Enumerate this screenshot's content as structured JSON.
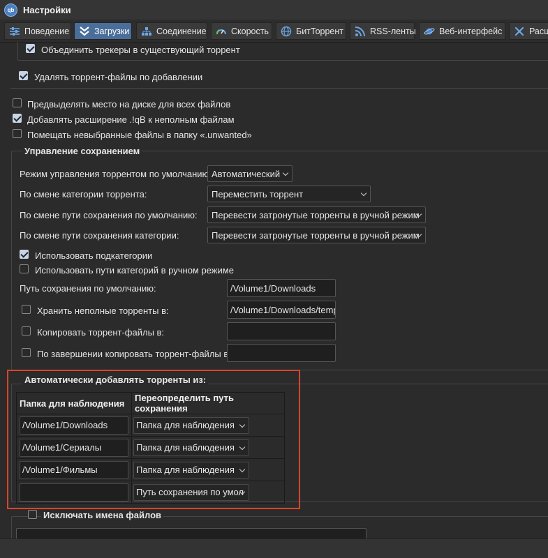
{
  "window": {
    "title": "Настройки",
    "app_icon_text": "qb"
  },
  "tabs": [
    {
      "label": "Поведение"
    },
    {
      "label": "Загрузки"
    },
    {
      "label": "Соединение"
    },
    {
      "label": "Скорость"
    },
    {
      "label": "БитТоррент"
    },
    {
      "label": "RSS-ленты"
    },
    {
      "label": "Веб-интерфейс"
    },
    {
      "label": "Расш"
    }
  ],
  "top": {
    "merge_trackers": "Объединить трекеры в существующий торрент",
    "delete_torrent_files": "Удалять торрент-файлы по добавлении",
    "preallocate": "Предвыделять место на диске для всех файлов",
    "append_qb": "Добавлять расширение .!qB к неполным файлам",
    "unwanted": "Помещать невыбранные файлы в папку «.unwanted»"
  },
  "save_management": {
    "title": "Управление сохранением",
    "rows": [
      {
        "label": "Режим управления торрентом по умолчанию:",
        "value": "Автоматический"
      },
      {
        "label": "По смене категории торрента:",
        "value": "Переместить торрент"
      },
      {
        "label": "По смене пути сохранения по умолчанию:",
        "value": "Перевести затронутые торренты в ручной режим"
      },
      {
        "label": "По смене пути сохранения категории:",
        "value": "Перевести затронутые торренты в ручной режим"
      }
    ],
    "use_subcategories": "Использовать подкатегории",
    "use_category_paths": "Использовать пути категорий в ручном режиме",
    "default_save_path_label": "Путь сохранения по умолчанию:",
    "default_save_path": "/Volume1/Downloads",
    "keep_incomplete_label": "Хранить неполные торренты в:",
    "keep_incomplete_path": "/Volume1/Downloads/temp",
    "copy_torrent_label": "Копировать торрент-файлы в:",
    "copy_torrent_path": "",
    "copy_finished_label": "По завершении копировать торрент-файлы в:",
    "copy_finished_path": ""
  },
  "auto_add": {
    "title": "Автоматически добавлять торренты из:",
    "columns": [
      "Папка для наблюдения",
      "Переопределить путь сохранения"
    ],
    "rows": [
      {
        "folder": "/Volume1/Downloads",
        "override": "Папка для наблюдения"
      },
      {
        "folder": "/Volume1/Сериалы",
        "override": "Папка для наблюдения"
      },
      {
        "folder": "/Volume1/Фильмы",
        "override": "Папка для наблюдения"
      },
      {
        "folder": "",
        "override": "Путь сохранения по умол"
      }
    ]
  },
  "exclude": {
    "title": "Исключать имена файлов"
  },
  "colors": {
    "accent_tab": "#4a6e9a",
    "highlight": "#d8452c"
  }
}
